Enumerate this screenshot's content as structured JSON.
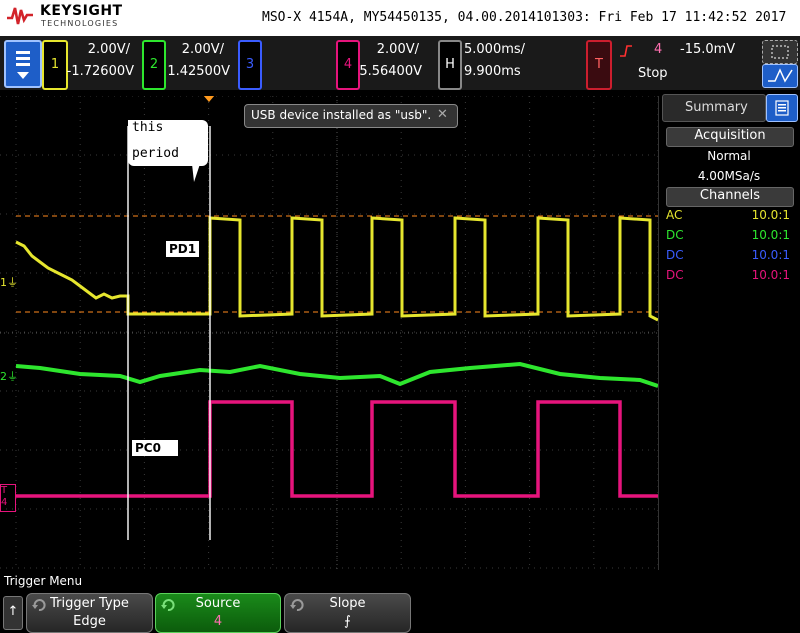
{
  "header": {
    "brand": "KEYSIGHT",
    "brand_sub": "TECHNOLOGIES",
    "model_line": "MSO-X 4154A, MY54450135, 04.00.2014101303: Fri Feb 17 11:42:52 2017"
  },
  "channels": [
    {
      "num": "1",
      "scale": "2.00V/",
      "offset": "-1.72600V",
      "color": "#e6e62e"
    },
    {
      "num": "2",
      "scale": "2.00V/",
      "offset": "1.42500V",
      "color": "#2ee62e"
    },
    {
      "num": "3",
      "scale": "",
      "offset": "",
      "color": "#3a5cff"
    },
    {
      "num": "4",
      "scale": "2.00V/",
      "offset": "5.56400V",
      "color": "#e6147c"
    }
  ],
  "horizontal": {
    "label": "H",
    "timebase": "5.000ms/",
    "delay": "9.900ms"
  },
  "trigger": {
    "label": "T",
    "source": "4",
    "level": "-15.0mV",
    "status": "Stop",
    "color": "#cc1e2e"
  },
  "notification": {
    "text": "USB device installed as \"usb\".",
    "close": "✕"
  },
  "annotations": {
    "callout_line1": "this",
    "callout_line2": "period",
    "pd1": "PD1",
    "pc0": "PC0"
  },
  "markers": {
    "ch1": "1",
    "ch2": "2",
    "ch4": "4",
    "trigger": "T"
  },
  "sidebar": {
    "summary_tab": "Summary",
    "acquisition_header": "Acquisition",
    "acq_mode": "Normal",
    "sample_rate": "4.00MSa/s",
    "channels_header": "Channels",
    "channel_rows": [
      {
        "coupling": "AC",
        "probe": "10.0:1",
        "color": "#e6e62e"
      },
      {
        "coupling": "DC",
        "probe": "10.0:1",
        "color": "#2ee62e"
      },
      {
        "coupling": "DC",
        "probe": "10.0:1",
        "color": "#3a5cff"
      },
      {
        "coupling": "DC",
        "probe": "10.0:1",
        "color": "#e6147c"
      }
    ]
  },
  "softkeys": {
    "menu_title": "Trigger Menu",
    "back": "↑",
    "items": [
      {
        "label": "Trigger Type",
        "value": "Edge"
      },
      {
        "label": "Source",
        "value": "4"
      },
      {
        "label": "Slope",
        "value": "⨍"
      }
    ]
  }
}
